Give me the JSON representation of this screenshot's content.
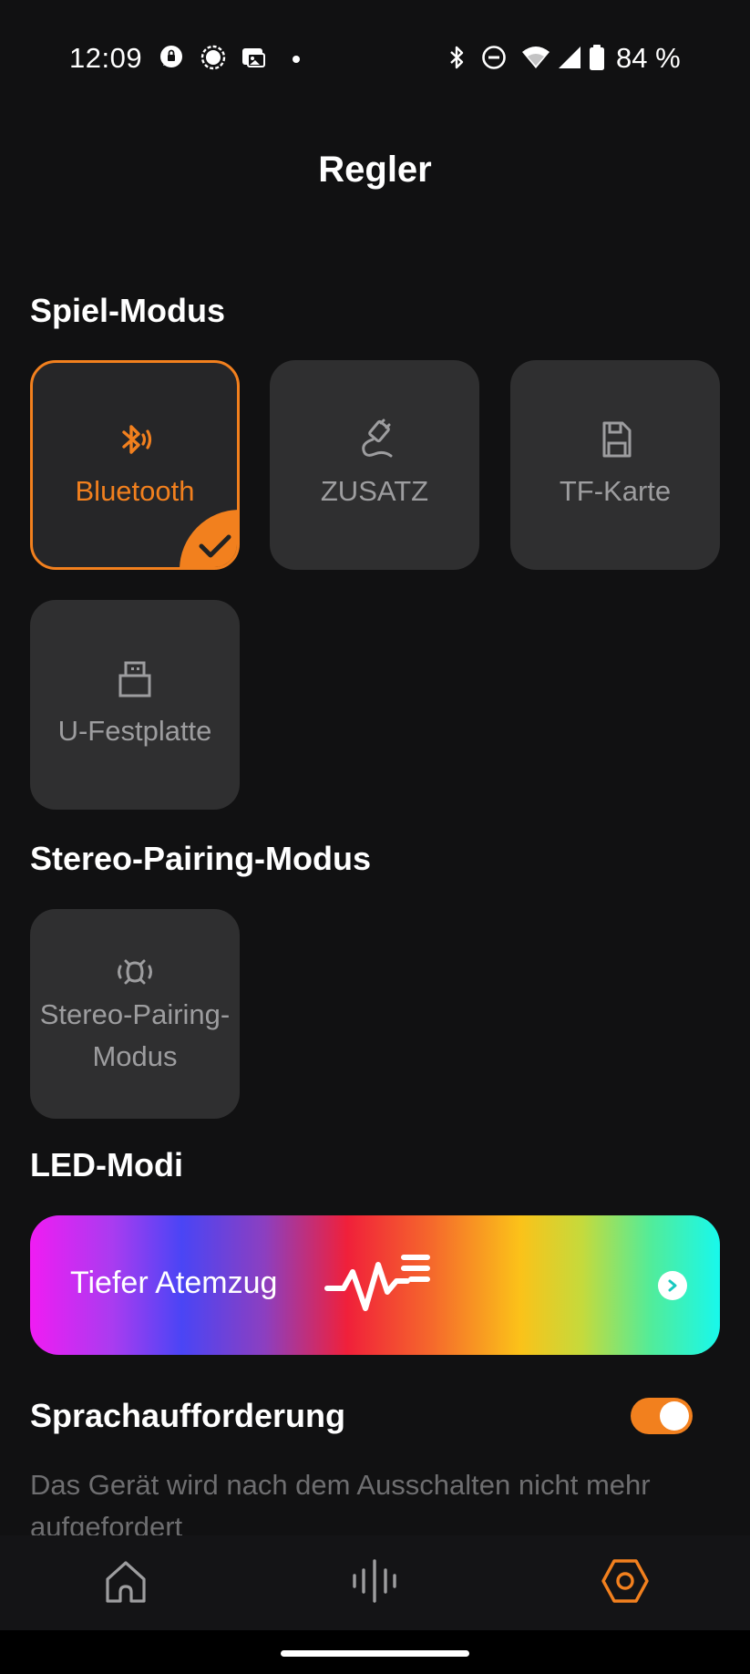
{
  "status_bar": {
    "time": "12:09",
    "battery_text": "84 %",
    "left_icons": [
      "chat-notification-icon",
      "signal-messenger-icon",
      "photo-message-icon",
      "dot-icon"
    ],
    "right_icons": [
      "bluetooth-icon",
      "do-not-disturb-icon",
      "wifi-icon",
      "cell-signal-icon",
      "battery-icon"
    ]
  },
  "header": {
    "title": "Regler"
  },
  "play_mode": {
    "title": "Spiel-Modus",
    "tiles": [
      {
        "label": "Bluetooth",
        "icon": "bluetooth-audio-icon",
        "selected": true
      },
      {
        "label": "ZUSATZ",
        "icon": "aux-cable-icon",
        "selected": false
      },
      {
        "label": "TF-Karte",
        "icon": "sd-card-icon",
        "selected": false
      },
      {
        "label": "U-Festplatte",
        "icon": "usb-drive-icon",
        "selected": false
      }
    ]
  },
  "stereo_pairing": {
    "title": "Stereo-Pairing-Modus",
    "tile_label_line1": "Stereo-Pairing-",
    "tile_label_line2": "Modus",
    "icon": "stereo-speaker-icon"
  },
  "led_modes": {
    "title": "LED-Modi",
    "current_mode": "Tiefer Atemzug",
    "icon": "waveform-icon"
  },
  "voice_prompt": {
    "title": "Sprachaufforderung",
    "enabled": true,
    "description": "Das Gerät wird nach dem Ausschalten nicht mehr aufgefordert"
  },
  "bottom_nav": {
    "items": [
      {
        "name": "home",
        "icon": "home-icon",
        "active": false
      },
      {
        "name": "equalizer",
        "icon": "equalizer-icon",
        "active": false
      },
      {
        "name": "settings",
        "icon": "settings-hexagon-icon",
        "active": true
      }
    ]
  },
  "colors": {
    "accent": "#f2801e",
    "background": "#111112",
    "tile": "#2f2f30",
    "tile_label": "#9d9d9f"
  }
}
